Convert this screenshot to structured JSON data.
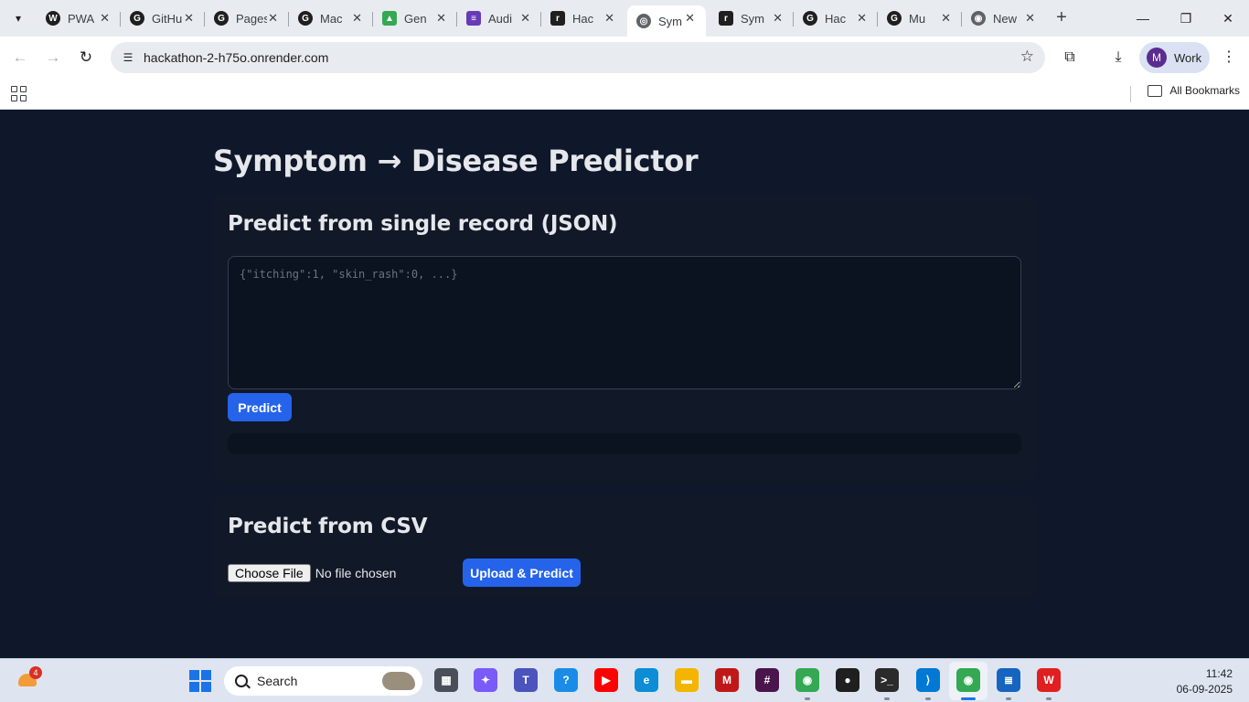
{
  "browser": {
    "tabs": [
      {
        "title": "PWA",
        "icon": "wordpress-icon",
        "color": "#1f1f1f"
      },
      {
        "title": "GitHub",
        "icon": "github-icon",
        "color": "#1f1f1f"
      },
      {
        "title": "Pages",
        "icon": "github-icon",
        "color": "#1f1f1f"
      },
      {
        "title": "Mac",
        "icon": "github-icon",
        "color": "#1f1f1f"
      },
      {
        "title": "Gen",
        "icon": "google-drive-icon",
        "color": "#34a853"
      },
      {
        "title": "Audi",
        "icon": "forms-icon",
        "color": "#673ab7"
      },
      {
        "title": "Hac",
        "icon": "render-icon",
        "color": "#1f1f1f"
      },
      {
        "title": "Sym",
        "icon": "globe-icon",
        "color": "#5f6368",
        "active": true
      },
      {
        "title": "Sym",
        "icon": "render-icon",
        "color": "#1f1f1f"
      },
      {
        "title": "Hac",
        "icon": "github-icon",
        "color": "#1f1f1f"
      },
      {
        "title": "Mu",
        "icon": "github-icon",
        "color": "#1f1f1f"
      },
      {
        "title": "New",
        "icon": "chrome-icon",
        "color": "#5f6368"
      }
    ],
    "url": "hackathon-2-h75o.onrender.com",
    "profile_initial": "M",
    "profile_name": "Work",
    "bookmarks_label": "All Bookmarks"
  },
  "page": {
    "title": "Symptom → Disease Predictor",
    "single": {
      "heading": "Predict from single record (JSON)",
      "placeholder": "{\"itching\":1, \"skin_rash\":0, ...}",
      "value": "",
      "predict_label": "Predict",
      "result": ""
    },
    "csv": {
      "heading": "Predict from CSV",
      "choose_label": "Choose File",
      "file_status": "No file chosen",
      "upload_label": "Upload & Predict"
    }
  },
  "taskbar": {
    "weather_badge": "4",
    "search_label": "Search",
    "time": "11:42",
    "date": "06-09-2025",
    "apps": [
      {
        "name": "task-view-icon",
        "color": "#4a4f59"
      },
      {
        "name": "copilot-icon",
        "color": "#7a5af8"
      },
      {
        "name": "teams-icon",
        "color": "#4b53bc"
      },
      {
        "name": "help-icon",
        "color": "#1a8ce8"
      },
      {
        "name": "youtube-icon",
        "color": "#ff0000"
      },
      {
        "name": "edge-icon",
        "color": "#0c8dd6"
      },
      {
        "name": "file-explorer-icon",
        "color": "#f4b400"
      },
      {
        "name": "mcafee-icon",
        "color": "#c01818"
      },
      {
        "name": "slack-icon",
        "color": "#4a154b"
      },
      {
        "name": "chrome-icon",
        "color": "#34a853"
      },
      {
        "name": "lens-icon",
        "color": "#1f1f1f"
      },
      {
        "name": "terminal-icon",
        "color": "#2b2b2b"
      },
      {
        "name": "vscode-icon",
        "color": "#0078d4"
      },
      {
        "name": "chrome-work-icon",
        "color": "#34a853"
      },
      {
        "name": "notepad-icon",
        "color": "#1565c0"
      },
      {
        "name": "wps-office-icon",
        "color": "#e02020"
      }
    ]
  }
}
